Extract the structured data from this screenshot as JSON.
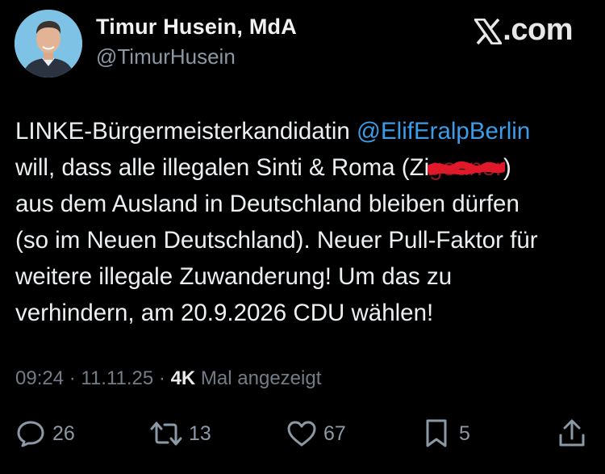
{
  "author": {
    "display_name": "Timur Husein, MdA",
    "handle": "@TimurHusein"
  },
  "brand": {
    "logo": "x-logo",
    "domain": ".com"
  },
  "tweet": {
    "line1_before": "LINKE-Bürgermeisterkandidatin ",
    "mention": "@ElifEralpBerlin",
    "line2_before": "will, dass alle illegalen Sinti & Roma (Zi",
    "line2_censored": "geuner",
    "line2_after": ")",
    "line3": "aus dem Ausland in Deutschland bleiben dürfen",
    "line4": "(so im Neuen Deutschland). Neuer Pull-Faktor für",
    "line5": "weitere illegale Zuwanderung! Um das zu",
    "line6": "verhindern, am 20.9.2026 CDU wählen!"
  },
  "meta": {
    "time": "09:24",
    "sep1": " · ",
    "date": "11.11.25",
    "sep2": " · ",
    "views": "4K",
    "views_label": " Mal angezeigt"
  },
  "actions": {
    "replies": "26",
    "reposts": "13",
    "likes": "67",
    "bookmarks": "5"
  },
  "icons": {
    "reply": "reply-icon",
    "repost": "repost-icon",
    "like": "heart-icon",
    "bookmark": "bookmark-icon",
    "share": "share-icon"
  },
  "colors": {
    "background": "#000000",
    "mention": "#3c9ce8",
    "secondary_text": "#8b98a5",
    "censor_mark": "#e0192a"
  }
}
